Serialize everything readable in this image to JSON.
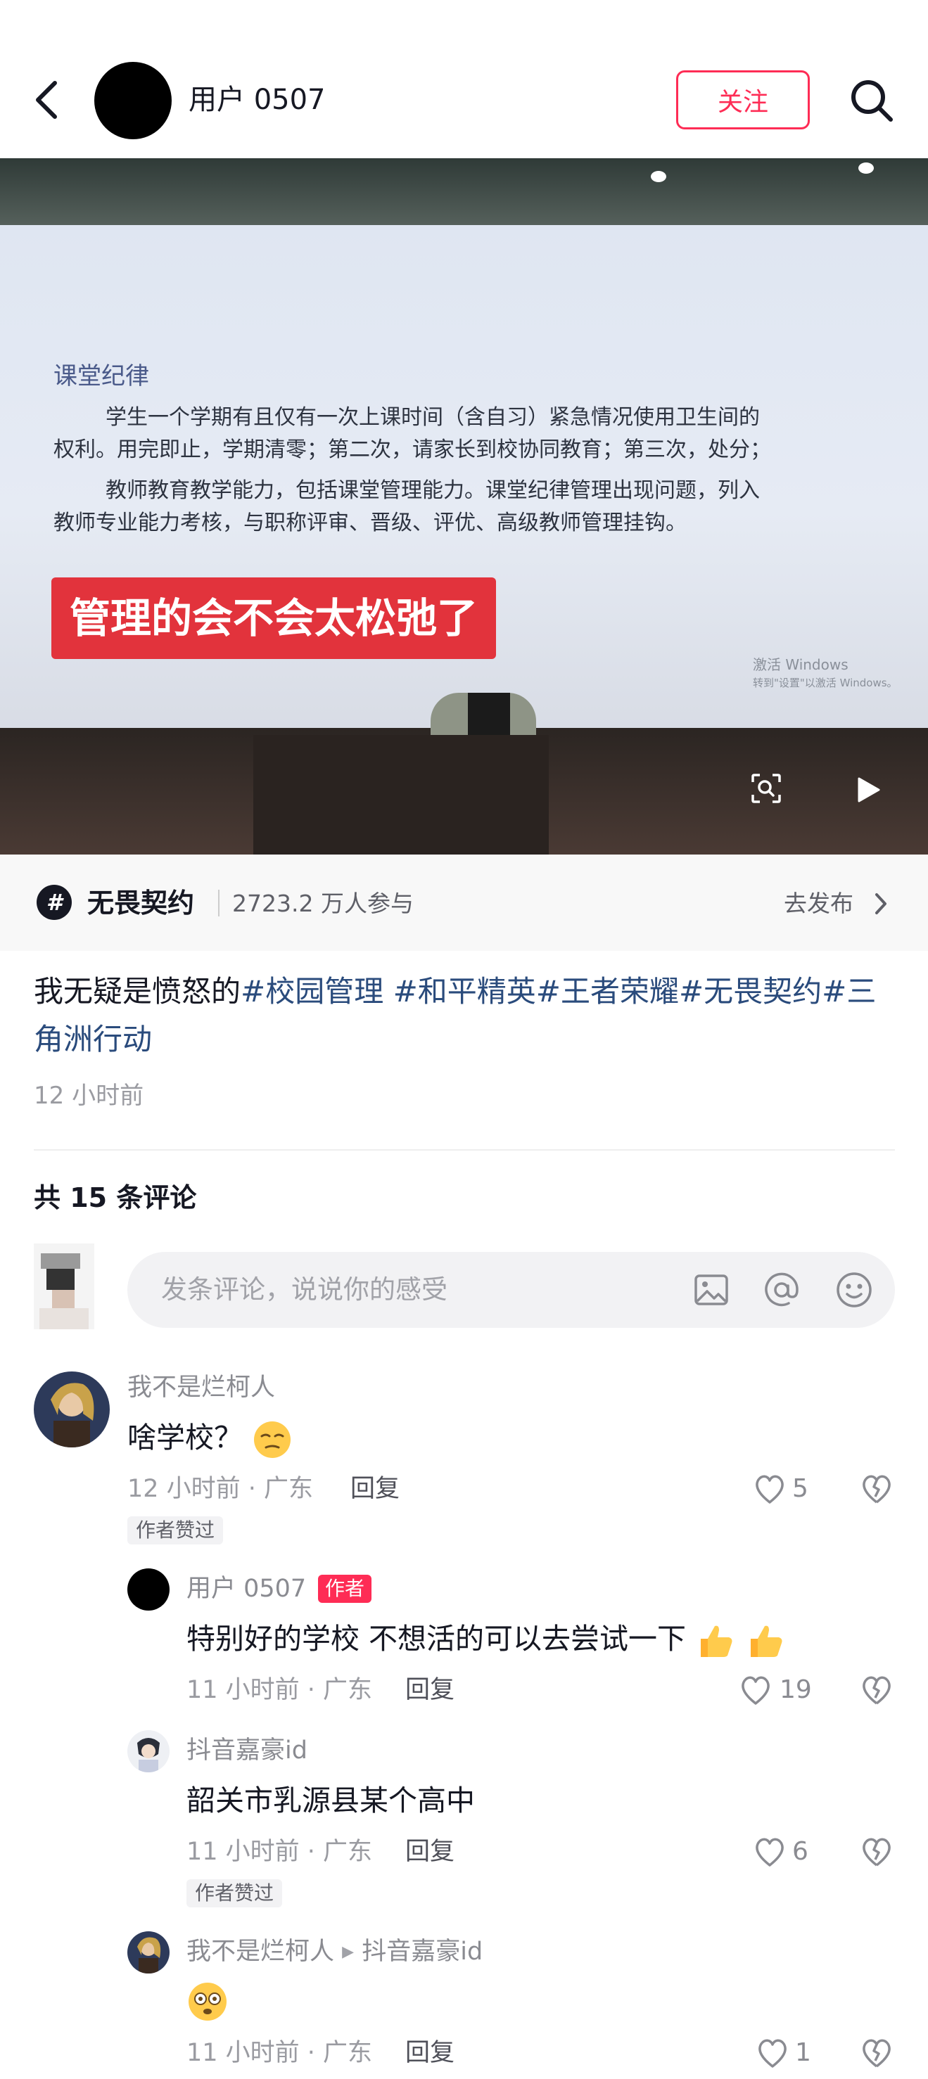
{
  "header": {
    "username": "用户 0507",
    "follow_label": "关注"
  },
  "video": {
    "slide_title": "课堂纪律",
    "slide_lines": [
      "学生一个学期有且仅有一次上课时间（含自习）紧急情况使用卫生间的",
      "权利。用完即止，学期清零；第二次，请家长到校协同教育；第三次，处分；",
      "教师教育教学能力，包括课堂管理能力。课堂纪律管理出现问题，列入",
      "教师专业能力考核，与职称评审、晋级、评优、高级教师管理挂钩。"
    ],
    "caption": "管理的会不会太松弛了",
    "watermark_line1": "激活 Windows",
    "watermark_line2": "转到\"设置\"以激活 Windows。"
  },
  "topic": {
    "name": "无畏契约",
    "participants": "2723.2 万人参与",
    "action": "去发布"
  },
  "post": {
    "text_plain": "我无疑是愤怒的",
    "tags": [
      "#校园管理",
      " #和平精英",
      "#王者荣耀",
      "#无畏契约",
      "#三角洲行动"
    ],
    "time": "12 小时前"
  },
  "comments_count": "共 15 条评论",
  "comment_input": {
    "placeholder": "发条评论，说说你的感受"
  },
  "comments": [
    {
      "name": "我不是烂柯人",
      "text": "啥学校？",
      "meta": "12 小时前 · 广东",
      "reply": "回复",
      "likes": "5",
      "badge": "作者赞过"
    },
    {
      "name": "用户 0507",
      "author_badge": "作者",
      "text": "特别好的学校 不想活的可以去尝试一下",
      "meta": "11 小时前 · 广东",
      "reply": "回复",
      "likes": "19"
    },
    {
      "name": "抖音嘉豪id",
      "text": "韶关市乳源县某个高中",
      "meta": "11 小时前 · 广东",
      "reply": "回复",
      "likes": "6",
      "badge": "作者赞过"
    },
    {
      "name": "我不是烂柯人",
      "reply_to": "抖音嘉豪id",
      "text": "",
      "meta": "11 小时前 · 广东",
      "reply": "回复",
      "likes": "1"
    }
  ],
  "colors": {
    "accent": "#fe2c55",
    "tag": "#2a4b7c",
    "caption_bg": "#e2333c"
  }
}
